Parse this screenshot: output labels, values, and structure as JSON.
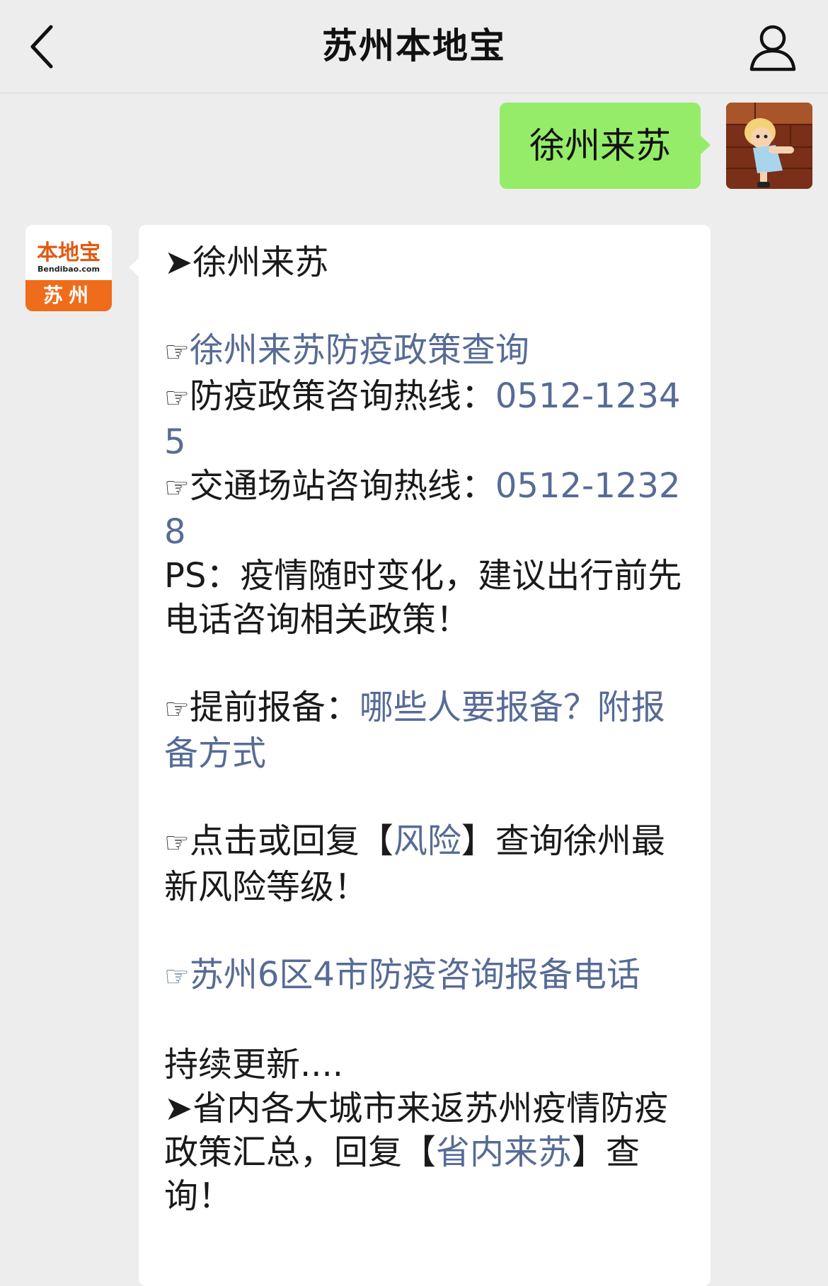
{
  "header": {
    "title": "苏州本地宝"
  },
  "outgoing": {
    "text": "徐州来苏"
  },
  "incoming": {
    "avatar": {
      "brand": "本地宝",
      "url": "Bendibao.com",
      "city": "苏州"
    },
    "heading": "➤徐州来苏",
    "hand": "☞",
    "policy_link": "徐州来苏防疫政策查询",
    "hotline1_label": "防疫政策咨询热线：",
    "hotline1_number": "0512-12345",
    "hotline2_label": "交通场站咨询热线：",
    "hotline2_number": "0512-12328",
    "ps_text": "PS：疫情随时变化，建议出行前先电话咨询相关政策！",
    "report_label": "提前报备：",
    "report_link": "哪些人要报备？附报备方式",
    "risk_prefix": "点击或回复【",
    "risk_link": "风险",
    "risk_suffix": "】查询徐州最新风险等级！",
    "suzhou_link": "苏州6区4市防疫咨询报备电话",
    "updating": "持续更新....",
    "province_prefix": "➤省内各大城市来返苏州疫情防疫政策汇总，回复【",
    "province_link": "省内来苏",
    "province_suffix": "】查询！"
  }
}
